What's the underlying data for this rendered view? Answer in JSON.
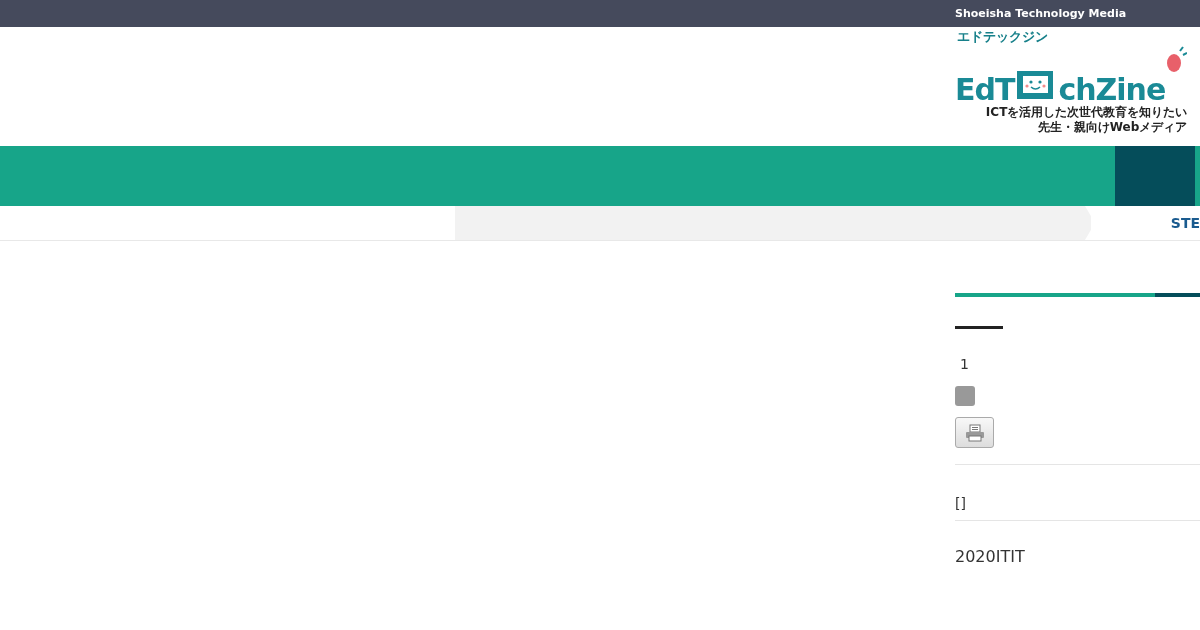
{
  "top_bar": {
    "text": "Shoeisha Technology Media"
  },
  "logo": {
    "kana": "エドテックジン",
    "name_left": "EdT",
    "name_right": "chZine",
    "tagline": [
      "ICTを活用した次世代教育を知りたい",
      "先生・親向けWebメディア"
    ]
  },
  "breadcrumb": {
    "current": "STE"
  },
  "sidebar": {
    "count": "1",
    "brackets": "[]",
    "text": "2020ITIT"
  }
}
